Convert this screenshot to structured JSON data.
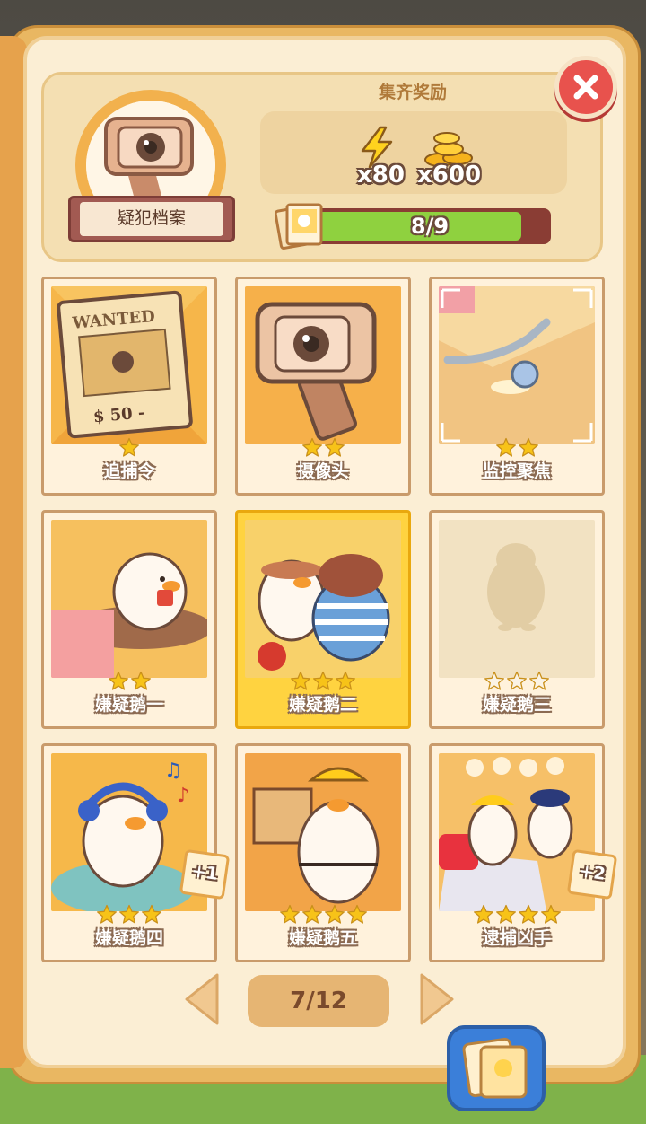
{
  "header": {
    "file_label": "疑犯档案",
    "reward_title": "集齐奖励",
    "rewards": [
      {
        "icon": "lightning-icon",
        "amount": "x80"
      },
      {
        "icon": "gold-coins-icon",
        "amount": "x600"
      }
    ],
    "progress_text": "8/9",
    "progress_value": 0.89
  },
  "cards": [
    {
      "label": "追捕令",
      "stars": 1,
      "collected": true,
      "art": "wanted-poster",
      "wanted_text": "WANTED",
      "price_text": "$ 50 -"
    },
    {
      "label": "摄像头",
      "stars": 2,
      "collected": true,
      "art": "security-camera"
    },
    {
      "label": "监控聚焦",
      "stars": 2,
      "collected": true,
      "art": "snail-with-spoon"
    },
    {
      "label": "嫌疑鹅一",
      "stars": 2,
      "collected": true,
      "art": "goose-eating"
    },
    {
      "label": "嫌疑鹅二",
      "stars": 3,
      "collected": true,
      "highlight": true,
      "art": "goose-boxer"
    },
    {
      "label": "嫌疑鹅三",
      "stars": 3,
      "collected": false,
      "art": "silhouette"
    },
    {
      "label": "嫌疑鹅四",
      "stars": 3,
      "collected": true,
      "badge": "+1",
      "art": "goose-headphones"
    },
    {
      "label": "嫌疑鹅五",
      "stars": 4,
      "collected": true,
      "art": "goose-builder"
    },
    {
      "label": "逮捕凶手",
      "stars": 4,
      "collected": true,
      "badge": "+2",
      "art": "goose-police"
    }
  ],
  "pagination": {
    "text": "7/12"
  },
  "colors": {
    "star": "#f7c318",
    "empty_star": "#fbf3e4",
    "accent": "#8fd13f",
    "close": "#e8524d"
  }
}
